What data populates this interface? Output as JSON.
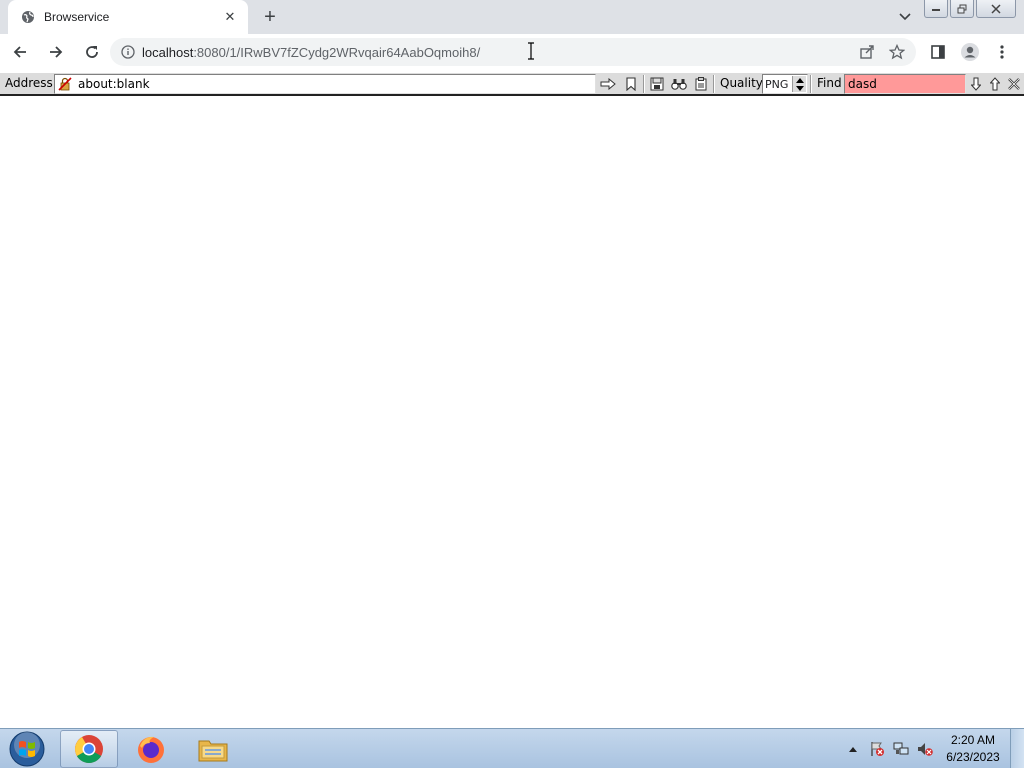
{
  "tab": {
    "title": "Browservice",
    "close_glyph": "✕"
  },
  "new_tab_glyph": "+",
  "omnibox": {
    "url_host": "localhost",
    "url_rest": ":8080/1/IRwBV7fZCydg2WRvqair64AabOqmoih8/"
  },
  "legacy": {
    "address_label": "Address",
    "address_value": "about:blank",
    "quality_label": "Quality",
    "quality_value": "PNG",
    "find_label": "Find",
    "find_value": "dasd"
  },
  "clock": {
    "time": "2:20 AM",
    "date": "6/23/2023"
  },
  "colors": {
    "find_bg": "#ff9999",
    "tabstrip_bg": "#dee1e6",
    "legacy_bg": "#dcdcdc"
  }
}
